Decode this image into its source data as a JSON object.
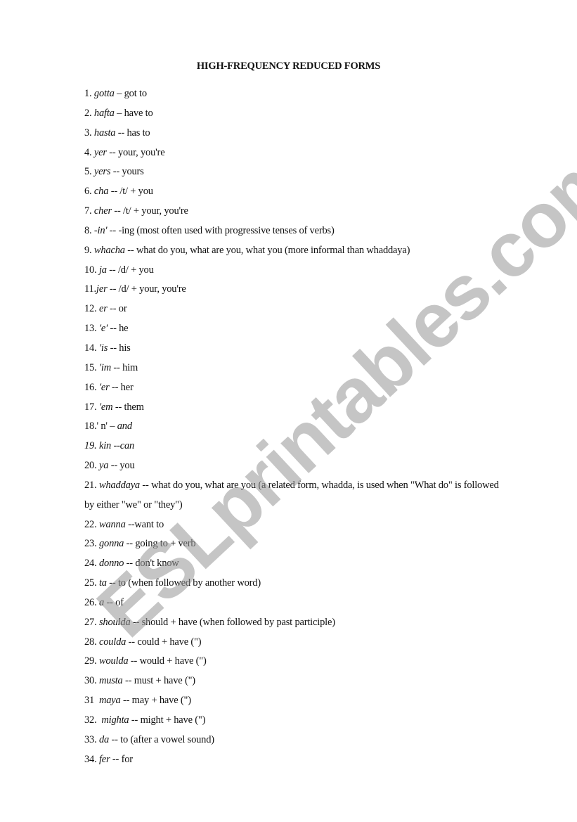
{
  "document": {
    "title": "HIGH-FREQUENCY REDUCED FORMS",
    "watermark": "ESLprintables.com",
    "items": [
      {
        "num": "1.",
        "form": "gotta",
        "meaning": " – got to"
      },
      {
        "num": "2.",
        "form": "hafta",
        "meaning": " – have to"
      },
      {
        "num": "3.",
        "form": "hasta",
        "meaning": " -- has to"
      },
      {
        "num": "4.",
        "form": "yer",
        "meaning": " -- your, you're"
      },
      {
        "num": "5.",
        "form": "yers",
        "meaning": " -- yours"
      },
      {
        "num": "6.",
        "form": "cha",
        "meaning": " -- /t/ + you"
      },
      {
        "num": "7.",
        "form": "cher",
        "meaning": " -- /t/ + your, you're"
      },
      {
        "num": "8.",
        "form": "-in'",
        "meaning": " -- -ing (most often used with progressive tenses of verbs)"
      },
      {
        "num": "9.",
        "form": "whacha",
        "meaning": " -- what do you, what are you, what you (more informal than whaddaya)"
      },
      {
        "num": "10.",
        "form": "ja",
        "meaning": " -- /d/ + you"
      },
      {
        "num": "11.",
        "form": "jer",
        "meaning": " -- /d/ + your, you're"
      },
      {
        "num": "12.",
        "form": "er",
        "meaning": " -- or"
      },
      {
        "num": "13.",
        "form": "'e'",
        "meaning": " -- he"
      },
      {
        "num": "14.",
        "form": "'is",
        "meaning": " -- his"
      },
      {
        "num": "15.",
        "form": "'im",
        "meaning": " -- him"
      },
      {
        "num": "16.",
        "form": "'er",
        "meaning": " -- her"
      },
      {
        "num": "17.",
        "form": "'em",
        "meaning": " -- them"
      },
      {
        "num": "18.",
        "form": "' n'",
        "meaning": " – and"
      },
      {
        "num": "19.",
        "form": "kin",
        "meaning": " --can"
      },
      {
        "num": "20.",
        "form": "ya",
        "meaning": " -- you"
      },
      {
        "num": "21.",
        "form": "whaddaya",
        "meaning": " -- what do you, what are you (a related form, whadda, is used when \"What do\" is followed by either \"we\" or \"they\")"
      },
      {
        "num": "22.",
        "form": "wanna",
        "meaning": " --want to"
      },
      {
        "num": "23.",
        "form": "gonna",
        "meaning": " -- going to + verb"
      },
      {
        "num": "24.",
        "form": "donno",
        "meaning": " -- don't know"
      },
      {
        "num": "25.",
        "form": "ta",
        "meaning": " -- to (when followed by another word)"
      },
      {
        "num": "26.",
        "form": "a",
        "meaning": " -- of"
      },
      {
        "num": "27.",
        "form": "shoulda",
        "meaning": " -- should + have (when followed by past participle)"
      },
      {
        "num": "28.",
        "form": "coulda",
        "meaning": " -- could + have (\")"
      },
      {
        "num": "29.",
        "form": "woulda",
        "meaning": " -- would + have (\")"
      },
      {
        "num": "30.",
        "form": "musta",
        "meaning": " -- must + have (\")"
      },
      {
        "num": "31",
        "form": "maya",
        "meaning": " -- may + have (\")"
      },
      {
        "num": "32.",
        "form": "mighta",
        "meaning": " -- might + have (\")"
      },
      {
        "num": "33.",
        "form": "da",
        "meaning": " -- to (after a vowel sound)"
      },
      {
        "num": "34.",
        "form": "fer",
        "meaning": " -- for"
      }
    ]
  }
}
